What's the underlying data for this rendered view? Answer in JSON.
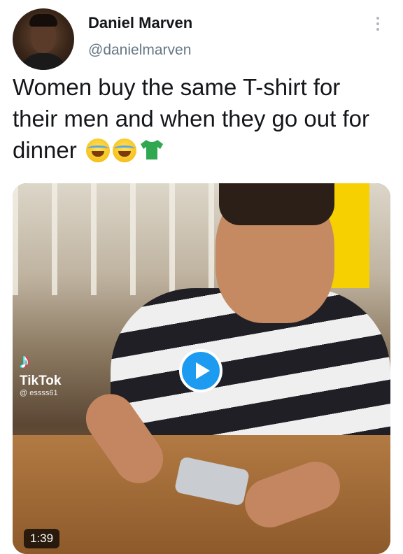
{
  "author": {
    "name": "Daniel Marven",
    "handle": "@danielmarven"
  },
  "tweet": {
    "text": "Women buy the same T-shirt for their men and when they go out for dinner",
    "emojis": [
      "face-with-tears-of-joy",
      "face-with-tears-of-joy",
      "t-shirt"
    ]
  },
  "media": {
    "watermark_brand": "TikTok",
    "watermark_user": "@ essss61",
    "duration": "1:39"
  },
  "colors": {
    "accent": "#1d9bf0",
    "text": "#14171a",
    "secondary": "#657786"
  }
}
